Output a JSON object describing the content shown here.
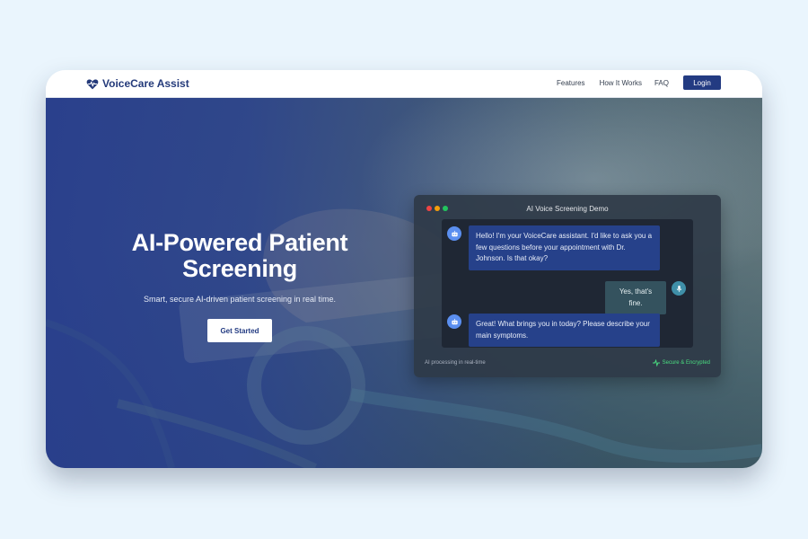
{
  "brand": {
    "name": "VoiceCare Assist",
    "icon": "heart-pulse-icon",
    "color": "#243a7a"
  },
  "nav": {
    "links": [
      "Features",
      "How It Works",
      "FAQ"
    ],
    "login_label": "Login"
  },
  "hero": {
    "title_line1": "AI-Powered Patient",
    "title_line2": "Screening",
    "subtitle": "Smart, secure AI-driven patient screening in real time.",
    "cta_label": "Get Started"
  },
  "demo": {
    "title": "AI Voice Screening Demo",
    "window_dots": [
      "#ef4444",
      "#f59e0b",
      "#22c55e"
    ],
    "messages": [
      {
        "role": "ai",
        "icon": "robot-icon",
        "text": "Hello! I'm your VoiceCare assistant. I'd like to ask you a few questions before your appointment with Dr. Johnson. Is that okay?"
      },
      {
        "role": "user",
        "icon": "microphone-icon",
        "text": "Yes, that's fine."
      },
      {
        "role": "ai",
        "icon": "robot-icon",
        "text": "Great! What brings you in today? Please describe your main symptoms."
      }
    ],
    "footer_left": "AI processing in real-time",
    "footer_right": "Secure & Encrypted",
    "footer_right_icon": "activity-icon"
  },
  "colors": {
    "accent": "#233b82",
    "ai_bubble": "#26418a",
    "user_bubble": "#34525e",
    "secure_green": "#4ade80"
  }
}
